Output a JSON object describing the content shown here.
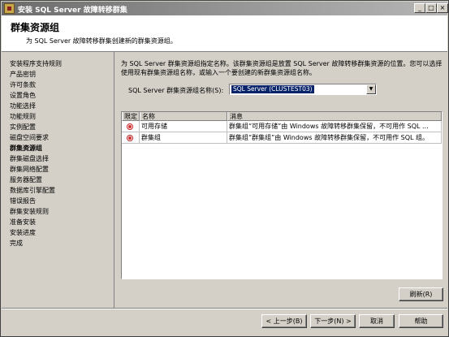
{
  "window": {
    "title": "安装 SQL Server 故障转移群集",
    "controls": {
      "minimize": "_",
      "maximize": "□",
      "close": "×"
    }
  },
  "header": {
    "title": "群集资源组",
    "subtitle": "为 SQL Server 故障转移群集创建新的群集资源组。"
  },
  "sidebar": {
    "items": [
      {
        "label": "安装程序支持规则"
      },
      {
        "label": "产品密钥"
      },
      {
        "label": "许可条款"
      },
      {
        "label": "设置角色"
      },
      {
        "label": "功能选择"
      },
      {
        "label": "功能规则"
      },
      {
        "label": "实例配置"
      },
      {
        "label": "磁盘空间要求"
      },
      {
        "label": "群集资源组"
      },
      {
        "label": "群集磁盘选择"
      },
      {
        "label": "群集网络配置"
      },
      {
        "label": "服务器配置"
      },
      {
        "label": "数据库引擎配置"
      },
      {
        "label": "错误报告"
      },
      {
        "label": "群集安装规则"
      },
      {
        "label": "准备安装"
      },
      {
        "label": "安装进度"
      },
      {
        "label": "完成"
      }
    ],
    "current": "群集资源组"
  },
  "main": {
    "intro": "为 SQL Server 群集资源组指定名称。该群集资源组是放置 SQL Server 故障转移群集资源的位置。您可以选择使用现有群集资源组名称，或输入一个要创建的新群集资源组名称。",
    "name_label": "SQL Server 群集资源组名称(S):",
    "name_value": "SQL Server (CLUSTEST03)",
    "grid": {
      "columns": [
        "限定",
        "名称",
        "消息"
      ],
      "rows": [
        {
          "status": "error-icon",
          "name": "可用存储",
          "message": "群集组“可用存储”由 Windows 故障转移群集保留，不可用作 SQL ..."
        },
        {
          "status": "error-icon",
          "name": "群集组",
          "message": "群集组“群集组”由 Windows 故障转移群集保留，不可用作 SQL 组。"
        }
      ]
    },
    "refresh_label": "刷新(R)"
  },
  "footer": {
    "back_label": "< 上一步(B)",
    "next_label": "下一步(N) >",
    "cancel_label": "取消",
    "help_label": "帮助"
  }
}
